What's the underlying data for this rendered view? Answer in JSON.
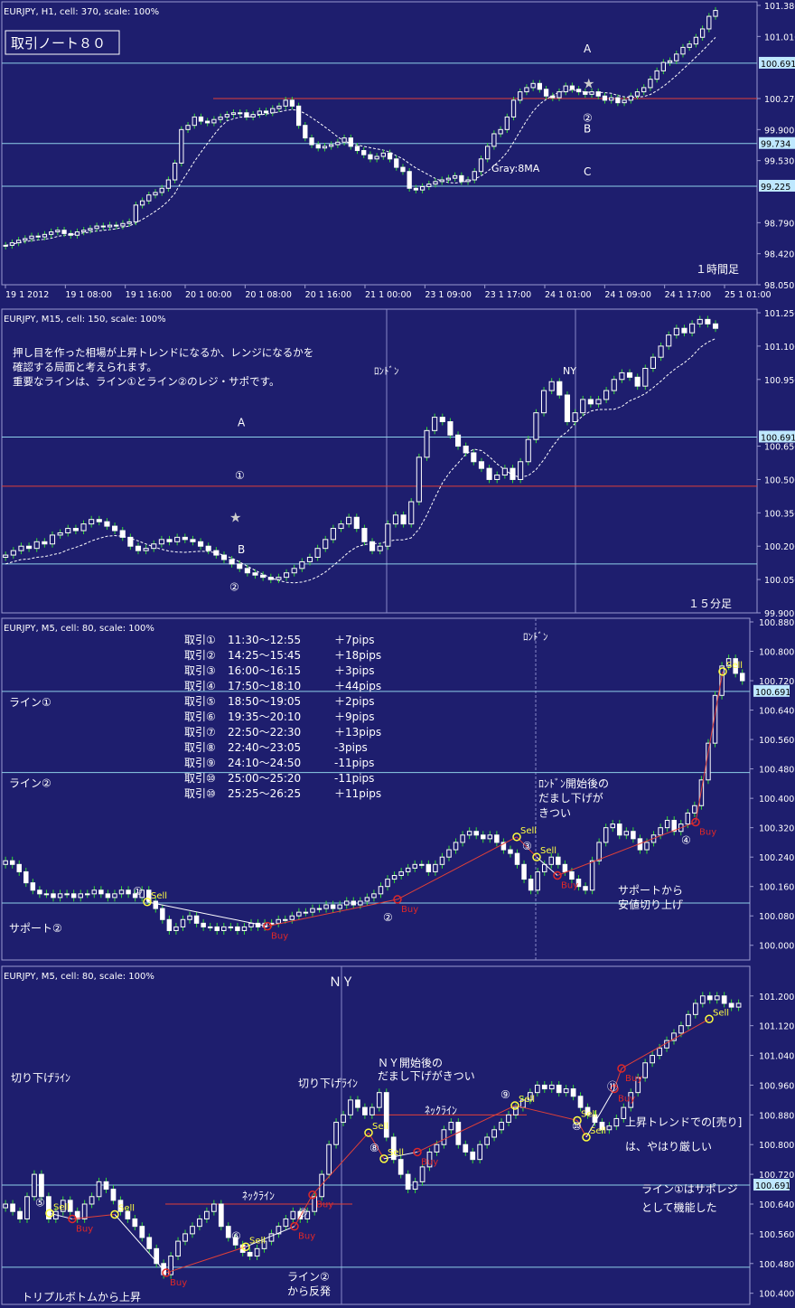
{
  "colors": {
    "bg": "#1e1e6e",
    "border": "#9a9ad0",
    "grid": "#8888c8",
    "hline": "#8ed0e8",
    "redline": "#e04038",
    "ma": "#ffffff",
    "candle_up": "#ffffff",
    "candle_up_fill": "#1e1e6e",
    "candle_down": "#ffffff",
    "wick_green": "#36d836",
    "sell": "#ffff40",
    "buy": "#e02828",
    "text": "#ffffff",
    "price_tag_bg": "#bfe8ff"
  },
  "chart_data": [
    {
      "type": "candlestick",
      "header": "EURJPY, H1, cell: 370, scale: 100%",
      "note_box": "取引ノート８０",
      "corner_label": "１時間足",
      "ma_label": "Gray:8MA",
      "y_ticks": [
        "101.380",
        "101.010",
        "100.691",
        "100.270",
        "99.900",
        "99.734",
        "99.530",
        "99.225",
        "98.790",
        "98.420",
        "98.050"
      ],
      "x_ticks": [
        "19 1 2012",
        "19 1 08:00",
        "19 1 16:00",
        "20 1 00:00",
        "20 1 08:00",
        "20 1 16:00",
        "21 1 00:00",
        "23 1 09:00",
        "23 1 17:00",
        "24 1 01:00",
        "24 1 09:00",
        "24 1 17:00",
        "25 1 01:00"
      ],
      "ylim": [
        98.05,
        101.38
      ],
      "h_lines": [
        {
          "price": 100.691,
          "tag": "100.691",
          "label": "A"
        },
        {
          "price": 99.734,
          "tag": "99.734",
          "label": "B"
        },
        {
          "price": 99.225,
          "tag": "99.225",
          "label": "C"
        }
      ],
      "red_line": {
        "price": 100.27,
        "x_from": 20,
        "x_to": 100
      },
      "markers": [
        {
          "text": "★",
          "x": 74,
          "price": 100.45
        },
        {
          "text": "②",
          "x": 74,
          "price": 100.05
        }
      ],
      "closes": [
        98.52,
        98.55,
        98.58,
        98.6,
        98.63,
        98.62,
        98.65,
        98.68,
        98.7,
        98.66,
        98.64,
        98.68,
        98.7,
        98.72,
        98.75,
        98.74,
        98.76,
        98.75,
        98.78,
        98.8,
        99.0,
        99.05,
        99.12,
        99.15,
        99.2,
        99.3,
        99.5,
        99.9,
        99.95,
        100.05,
        100.0,
        99.98,
        100.02,
        100.05,
        100.08,
        100.1,
        100.1,
        100.05,
        100.08,
        100.12,
        100.1,
        100.15,
        100.18,
        100.25,
        100.18,
        99.95,
        99.8,
        99.72,
        99.68,
        99.7,
        99.72,
        99.75,
        99.8,
        99.7,
        99.65,
        99.6,
        99.55,
        99.58,
        99.62,
        99.55,
        99.45,
        99.4,
        99.2,
        99.18,
        99.22,
        99.25,
        99.28,
        99.3,
        99.32,
        99.35,
        99.28,
        99.3,
        99.4,
        99.55,
        99.7,
        99.85,
        99.9,
        100.05,
        100.25,
        100.35,
        100.4,
        100.45,
        100.38,
        100.3,
        100.28,
        100.35,
        100.42,
        100.38,
        100.35,
        100.32,
        100.35,
        100.3,
        100.25,
        100.28,
        100.22,
        100.25,
        100.3,
        100.35,
        100.4,
        100.5,
        100.6,
        100.7,
        100.72,
        100.8,
        100.88,
        100.92,
        101.0,
        101.1,
        101.25,
        101.32
      ]
    },
    {
      "type": "candlestick",
      "header": "EURJPY, M15, cell: 150, scale: 100%",
      "notes": [
        "押し目を作った相場が上昇トレンドになるか、レンジになるかを",
        "確認する局面と考えられます。",
        "重要なラインは、ライン①とライン②のレジ・サポです。"
      ],
      "session_labels": [
        {
          "text": "ﾛﾝﾄﾞﾝ",
          "x": 428
        },
        {
          "text": "NY",
          "x": 637
        }
      ],
      "corner_label": "１５分足",
      "y_ticks": [
        "101.250",
        "101.100",
        "100.950",
        "100.691",
        "100.650",
        "100.500",
        "100.350",
        "100.200",
        "100.050",
        "99.900"
      ],
      "ylim": [
        99.9,
        101.25
      ],
      "h_lines": [
        {
          "price": 100.691,
          "tag": "100.691",
          "label": "A"
        },
        {
          "price": 100.12,
          "tag": "",
          "label": "B"
        }
      ],
      "red_line": {
        "price": 100.47,
        "label": "①"
      },
      "markers": [
        {
          "text": "★",
          "x": 0.3,
          "price": 100.33
        },
        {
          "text": "②",
          "x": 0.3,
          "price": 100.02
        }
      ],
      "closes": [
        100.16,
        100.18,
        100.2,
        100.19,
        100.22,
        100.21,
        100.25,
        100.26,
        100.28,
        100.27,
        100.3,
        100.32,
        100.31,
        100.29,
        100.27,
        100.24,
        100.2,
        100.18,
        100.19,
        100.21,
        100.23,
        100.22,
        100.24,
        100.23,
        100.22,
        100.2,
        100.18,
        100.16,
        100.14,
        100.12,
        100.1,
        100.08,
        100.07,
        100.06,
        100.05,
        100.06,
        100.08,
        100.1,
        100.13,
        100.15,
        100.19,
        100.23,
        100.28,
        100.3,
        100.33,
        100.28,
        100.22,
        100.18,
        100.2,
        100.3,
        100.34,
        100.3,
        100.4,
        100.6,
        100.72,
        100.78,
        100.76,
        100.7,
        100.65,
        100.62,
        100.58,
        100.55,
        100.5,
        100.52,
        100.55,
        100.5,
        100.58,
        100.68,
        100.8,
        100.9,
        100.94,
        100.88,
        100.76,
        100.8,
        100.86,
        100.84,
        100.86,
        100.9,
        100.95,
        100.98,
        100.96,
        100.92,
        101.0,
        101.05,
        101.1,
        101.15,
        101.18,
        101.16,
        101.2,
        101.22,
        101.2,
        101.18
      ]
    },
    {
      "type": "candlestick",
      "header": "EURJPY, M5, cell: 80, scale: 100%",
      "session_labels": [
        {
          "text": "ﾛﾝﾄﾞﾝ",
          "x": 593
        }
      ],
      "trades": [
        {
          "label": "取引①",
          "time": "11:30～12:55",
          "pips": "＋7pips"
        },
        {
          "label": "取引②",
          "time": "14:25～15:45",
          "pips": "＋18pips"
        },
        {
          "label": "取引③",
          "time": "16:00～16:15",
          "pips": "＋3pips"
        },
        {
          "label": "取引④",
          "time": "17:50～18:10",
          "pips": "＋44pips"
        },
        {
          "label": "取引⑤",
          "time": "18:50～19:05",
          "pips": "＋2pips"
        },
        {
          "label": "取引⑥",
          "time": "19:35～20:10",
          "pips": "＋9pips"
        },
        {
          "label": "取引⑦",
          "time": "22:50～22:30",
          "pips": "＋13pips"
        },
        {
          "label": "取引⑧",
          "time": "22:40～23:05",
          "pips": "-3pips"
        },
        {
          "label": "取引⑨",
          "time": "24:10～24:50",
          "pips": "-11pips"
        },
        {
          "label": "取引⑩",
          "time": "25:00～25:20",
          "pips": "-11pips"
        },
        {
          "label": "取引⑩",
          "time": "25:25～26:25",
          "pips": "＋11pips"
        }
      ],
      "left_labels": [
        {
          "text": "ライン①",
          "price": 100.691
        },
        {
          "text": "ライン②",
          "price": 100.47
        },
        {
          "text": "サポート②",
          "price": 100.08
        }
      ],
      "annotations": [
        {
          "text": "ﾛﾝﾄﾞﾝ開始後の",
          "x": 596,
          "price": 100.43
        },
        {
          "text": "だまし下げが",
          "x": 596,
          "price": 100.39
        },
        {
          "text": "きつい",
          "x": 596,
          "price": 100.35
        },
        {
          "text": "サポートから",
          "x": 684,
          "price": 100.14
        },
        {
          "text": "安値切り上げ",
          "x": 684,
          "price": 100.1
        }
      ],
      "y_ticks": [
        "100.880",
        "100.800",
        "100.720",
        "100.691",
        "100.640",
        "100.560",
        "100.480",
        "100.400",
        "100.320",
        "100.240",
        "100.160",
        "100.080",
        "100.000"
      ],
      "ylim": [
        99.96,
        100.88
      ],
      "h_lines": [
        {
          "price": 100.691,
          "tag": "100.691"
        },
        {
          "price": 100.47,
          "tag": ""
        },
        {
          "price": 100.115,
          "tag": ""
        }
      ],
      "signals": [
        {
          "kind": "Sell",
          "num": "①",
          "x": 163,
          "price": 100.118
        },
        {
          "kind": "Buy",
          "x": 296,
          "price": 100.052
        },
        {
          "kind": "Buy",
          "num": "②",
          "x": 440,
          "price": 100.125
        },
        {
          "kind": "Sell",
          "x": 572,
          "price": 100.295
        },
        {
          "kind": "Sell",
          "num": "③",
          "x": 594,
          "price": 100.24
        },
        {
          "kind": "Buy",
          "x": 617,
          "price": 100.19
        },
        {
          "kind": "Buy",
          "num": "④",
          "x": 770,
          "price": 100.335
        },
        {
          "kind": "Sell",
          "x": 800,
          "price": 100.745
        }
      ],
      "closes": [
        100.23,
        100.22,
        100.2,
        100.17,
        100.15,
        100.14,
        100.14,
        100.13,
        100.14,
        100.14,
        100.13,
        100.14,
        100.14,
        100.15,
        100.14,
        100.13,
        100.14,
        100.15,
        100.14,
        100.13,
        100.15,
        100.12,
        100.1,
        100.07,
        100.04,
        100.05,
        100.07,
        100.08,
        100.06,
        100.05,
        100.05,
        100.04,
        100.05,
        100.05,
        100.04,
        100.05,
        100.06,
        100.05,
        100.06,
        100.06,
        100.07,
        100.07,
        100.08,
        100.09,
        100.09,
        100.1,
        100.1,
        100.11,
        100.1,
        100.11,
        100.12,
        100.11,
        100.12,
        100.13,
        100.14,
        100.16,
        100.18,
        100.19,
        100.2,
        100.21,
        100.22,
        100.22,
        100.2,
        100.22,
        100.24,
        100.26,
        100.28,
        100.3,
        100.31,
        100.3,
        100.29,
        100.3,
        100.28,
        100.26,
        100.25,
        100.22,
        100.18,
        100.15,
        100.2,
        100.22,
        100.24,
        100.22,
        100.2,
        100.18,
        100.16,
        100.15,
        100.23,
        100.28,
        100.32,
        100.33,
        100.3,
        100.31,
        100.29,
        100.26,
        100.28,
        100.3,
        100.32,
        100.34,
        100.31,
        100.33,
        100.36,
        100.38,
        100.45,
        100.55,
        100.68,
        100.76,
        100.78,
        100.74,
        100.72
      ]
    },
    {
      "type": "candlestick",
      "header": "EURJPY, M5, cell: 80, scale: 100%",
      "session_labels": [
        {
          "text": "ＮＹ",
          "x": 378
        }
      ],
      "annotations": [
        {
          "text": "切り下げﾗｲﾝ",
          "x": 12,
          "price": 100.97
        },
        {
          "text": "切り下げﾗｲﾝ",
          "x": 330,
          "price": 100.955
        },
        {
          "text": "ＮＹ開始後の",
          "x": 418,
          "price": 101.01
        },
        {
          "text": "だまし下げがきつい",
          "x": 418,
          "price": 100.975
        },
        {
          "text": "ﾈｯｸﾗｲﾝ",
          "x": 470,
          "price": 100.882
        },
        {
          "text": "ﾈｯｸﾗｲﾝ",
          "x": 268,
          "price": 100.652
        },
        {
          "text": "上昇トレンドでの[売り]",
          "x": 692,
          "price": 100.85
        },
        {
          "text": "は、やはり厳しい",
          "x": 692,
          "price": 100.785
        },
        {
          "text": "ライン①はサポレジ",
          "x": 710,
          "price": 100.67
        },
        {
          "text": "として機能した",
          "x": 710,
          "price": 100.62
        },
        {
          "text": "トリプルボトムから上昇",
          "x": 24,
          "price": 100.38
        },
        {
          "text": "ライン②",
          "x": 318,
          "price": 100.435
        },
        {
          "text": "から反発",
          "x": 318,
          "price": 100.395
        }
      ],
      "y_ticks": [
        "101.200",
        "101.120",
        "101.040",
        "100.960",
        "100.880",
        "100.800",
        "100.720",
        "100.691",
        "100.640",
        "100.560",
        "100.480",
        "100.400"
      ],
      "ylim": [
        100.37,
        101.27
      ],
      "h_lines": [
        {
          "price": 100.691,
          "tag": "100.691"
        },
        {
          "price": 100.47,
          "tag": ""
        }
      ],
      "red_neck_lines": [
        {
          "price": 100.64,
          "x_from": 183,
          "x_to": 390
        },
        {
          "price": 100.88,
          "x_from": 413,
          "x_to": 583
        }
      ],
      "signals": [
        {
          "kind": "Sell",
          "num": "⑤",
          "x": 55,
          "price": 100.615
        },
        {
          "kind": "Buy",
          "x": 80,
          "price": 100.6
        },
        {
          "kind": "Sell",
          "x": 127,
          "price": 100.612
        },
        {
          "kind": "Buy",
          "x": 184,
          "price": 100.455
        },
        {
          "kind": "Sell",
          "num": "⑥",
          "x": 272,
          "price": 100.525
        },
        {
          "kind": "Buy",
          "x": 326,
          "price": 100.58
        },
        {
          "kind": "Buy",
          "num": "⑦",
          "x": 346,
          "price": 100.665
        },
        {
          "kind": "Sell",
          "x": 408,
          "price": 100.832
        },
        {
          "kind": "Sell",
          "num": "⑧",
          "x": 425,
          "price": 100.762
        },
        {
          "kind": "Buy",
          "x": 462,
          "price": 100.78
        },
        {
          "kind": "Sell",
          "num": "⑨",
          "x": 570,
          "price": 100.905
        },
        {
          "kind": "Sell",
          "x": 639,
          "price": 100.865
        },
        {
          "kind": "Sell",
          "num": "⑩",
          "x": 649,
          "price": 100.82
        },
        {
          "kind": "Buy",
          "x": 680,
          "price": 100.95
        },
        {
          "kind": "Buy",
          "num": "⑪",
          "x": 688,
          "price": 101.005
        },
        {
          "kind": "Sell",
          "x": 785,
          "price": 101.138
        }
      ],
      "closes": [
        100.64,
        100.62,
        100.6,
        100.66,
        100.72,
        100.66,
        100.6,
        100.62,
        100.65,
        100.62,
        100.6,
        100.64,
        100.66,
        100.7,
        100.68,
        100.65,
        100.62,
        100.6,
        100.58,
        100.55,
        100.52,
        100.48,
        100.45,
        100.5,
        100.54,
        100.56,
        100.58,
        100.6,
        100.62,
        100.64,
        100.58,
        100.55,
        100.53,
        100.51,
        100.5,
        100.52,
        100.54,
        100.56,
        100.58,
        100.6,
        100.62,
        100.6,
        100.62,
        100.66,
        100.72,
        100.8,
        100.86,
        100.88,
        100.92,
        100.9,
        100.88,
        100.9,
        100.94,
        100.82,
        100.76,
        100.72,
        100.68,
        100.7,
        100.74,
        100.78,
        100.8,
        100.84,
        100.86,
        100.8,
        100.78,
        100.76,
        100.8,
        100.82,
        100.84,
        100.86,
        100.88,
        100.9,
        100.92,
        100.94,
        100.96,
        100.95,
        100.96,
        100.94,
        100.95,
        100.93,
        100.9,
        100.88,
        100.86,
        100.84,
        100.85,
        100.87,
        100.9,
        100.94,
        100.98,
        101.02,
        101.04,
        101.06,
        101.08,
        101.1,
        101.12,
        101.15,
        101.18,
        101.2,
        101.19,
        101.2,
        101.18,
        101.17,
        101.18
      ]
    }
  ]
}
